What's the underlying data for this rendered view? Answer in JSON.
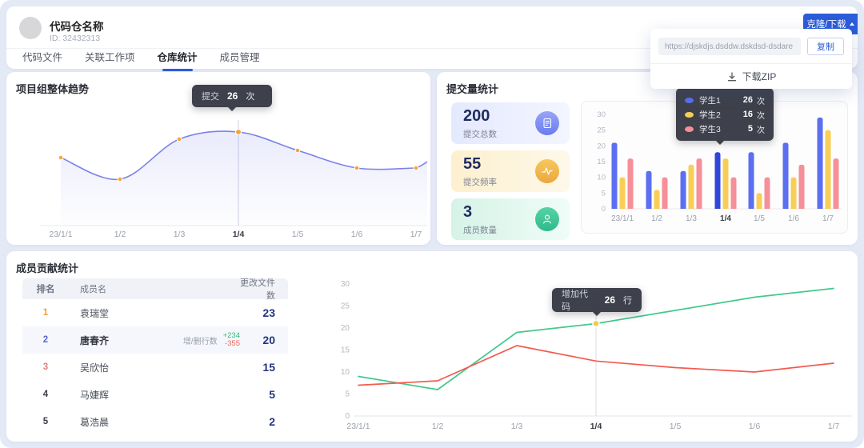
{
  "header": {
    "title": "代码仓名称",
    "repo_id": "ID: 32432313",
    "tabs": [
      {
        "label": "代码文件",
        "active": false
      },
      {
        "label": "关联工作项",
        "active": false
      },
      {
        "label": "仓库统计",
        "active": true
      },
      {
        "label": "成员管理",
        "active": false
      }
    ],
    "clone_button_label": "克隆/下载"
  },
  "clone_dropdown": {
    "url": "https://djskdjs.dsddw.dskdsd-dsdare",
    "copy_label": "复制",
    "download_zip_label": "下载ZIP"
  },
  "trend_card": {
    "title": "项目组整体趋势",
    "tooltip": {
      "label": "提交",
      "value": "26",
      "unit": "次"
    },
    "chart_data": {
      "type": "line",
      "categories": [
        "23/1/1",
        "1/2",
        "1/3",
        "1/4",
        "1/5",
        "1/6",
        "1/7"
      ],
      "values": [
        19,
        13,
        24,
        26,
        21,
        16,
        16
      ],
      "highlight_index": 3,
      "line_color": "#7b82e8",
      "area_color": "#7b82e8",
      "point_color": "#f5a53f",
      "grid": false
    }
  },
  "commits_card": {
    "title": "提交量统计",
    "stats": [
      {
        "value": "200",
        "label": "提交总数",
        "icon": "document-icon"
      },
      {
        "value": "55",
        "label": "提交频率",
        "icon": "pulse-icon"
      },
      {
        "value": "3",
        "label": "成员数量",
        "icon": "members-icon"
      }
    ],
    "tooltip": {
      "rows": [
        {
          "name": "学生1",
          "value": "26",
          "unit": "次",
          "color": "#5b6ff0"
        },
        {
          "name": "学生2",
          "value": "16",
          "unit": "次",
          "color": "#f8ce57"
        },
        {
          "name": "学生3",
          "value": "5",
          "unit": "次",
          "color": "#f78f98"
        }
      ]
    },
    "chart_data": {
      "type": "bar",
      "categories": [
        "23/1/1",
        "1/2",
        "1/3",
        "1/4",
        "1/5",
        "1/6",
        "1/7"
      ],
      "series": [
        {
          "name": "学生1",
          "color": "#5b6ff0",
          "values": [
            21,
            12,
            12,
            18,
            18,
            21,
            29
          ]
        },
        {
          "name": "学生2",
          "color": "#f8ce57",
          "values": [
            10,
            6,
            14,
            16,
            5,
            10,
            25
          ]
        },
        {
          "name": "学生3",
          "color": "#f78f98",
          "values": [
            16,
            10,
            16,
            10,
            10,
            14,
            16
          ]
        }
      ],
      "ylim": [
        0,
        30
      ],
      "yticks": [
        0,
        5,
        10,
        15,
        20,
        25,
        30
      ],
      "highlight_index": 3,
      "highlight_color": "#2f46d9"
    }
  },
  "contrib_card": {
    "title": "成员贡献统计",
    "table": {
      "headers": [
        "排名",
        "成员名",
        "更改文件数"
      ],
      "rows": [
        {
          "rank": "1",
          "name": "袁瑞堂",
          "files": "23"
        },
        {
          "rank": "2",
          "name": "唐春齐",
          "files": "20",
          "lines_label": "增/删行数",
          "added": "+234",
          "removed": "-355"
        },
        {
          "rank": "3",
          "name": "吴欣怡",
          "files": "15"
        },
        {
          "rank": "4",
          "name": "马婕辉",
          "files": "5"
        },
        {
          "rank": "5",
          "name": "葛浩晨",
          "files": "2"
        }
      ]
    },
    "tooltip": {
      "label": "增加代码",
      "value": "26",
      "unit": "行"
    },
    "chart_data": {
      "type": "line",
      "categories": [
        "23/1/1",
        "1/2",
        "1/3",
        "1/4",
        "1/5",
        "1/6",
        "1/7"
      ],
      "series": [
        {
          "color": "#42c98e",
          "values": [
            9,
            6,
            19,
            21,
            24,
            27,
            29
          ]
        },
        {
          "color": "#f25a4f",
          "values": [
            7,
            8,
            16,
            12.5,
            11,
            10,
            12
          ]
        }
      ],
      "ylim": [
        0,
        30
      ],
      "yticks": [
        0,
        5,
        10,
        15,
        20,
        25,
        30
      ],
      "highlight_index": 3,
      "highlight_point_color": "#f7c948"
    }
  },
  "colors": {
    "accent_blue": "#2b5cd9",
    "page_bg": "#e4e9f6",
    "tooltip_bg": "#2f333d",
    "stat_number": "#1e2c5e"
  }
}
